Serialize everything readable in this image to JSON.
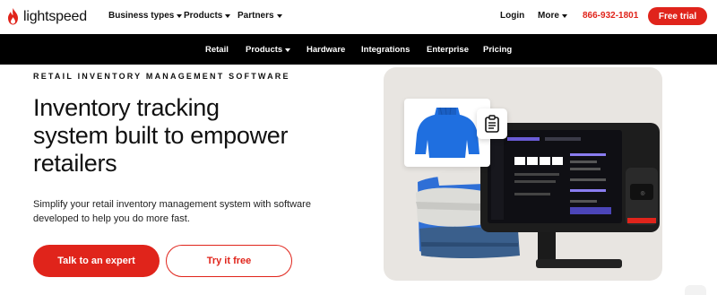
{
  "brand": {
    "name": "lightspeed",
    "accent": "#e0241b"
  },
  "topnav": {
    "items": [
      {
        "label": "Business types",
        "has_dropdown": true
      },
      {
        "label": "Products",
        "has_dropdown": true
      },
      {
        "label": "Partners",
        "has_dropdown": true
      }
    ],
    "login": "Login",
    "more": "More",
    "phone": "866-932-1801",
    "cta": "Free trial"
  },
  "subnav": {
    "items": [
      "Retail",
      "Products",
      "Hardware",
      "Integrations",
      "Enterprise",
      "Pricing"
    ],
    "active": "Products"
  },
  "hero": {
    "eyebrow": "RETAIL INVENTORY MANAGEMENT SOFTWARE",
    "headline_lines": [
      "Inventory tracking",
      "system built to empower",
      "retailers"
    ],
    "subtext": "Simplify your retail inventory management system with software developed to help you do more fast.",
    "primary_cta": "Talk to an expert",
    "secondary_cta": "Try it free"
  },
  "icons": [
    "lightspeed-logo-icon",
    "clipboard-icon",
    "caret-down-icon"
  ]
}
